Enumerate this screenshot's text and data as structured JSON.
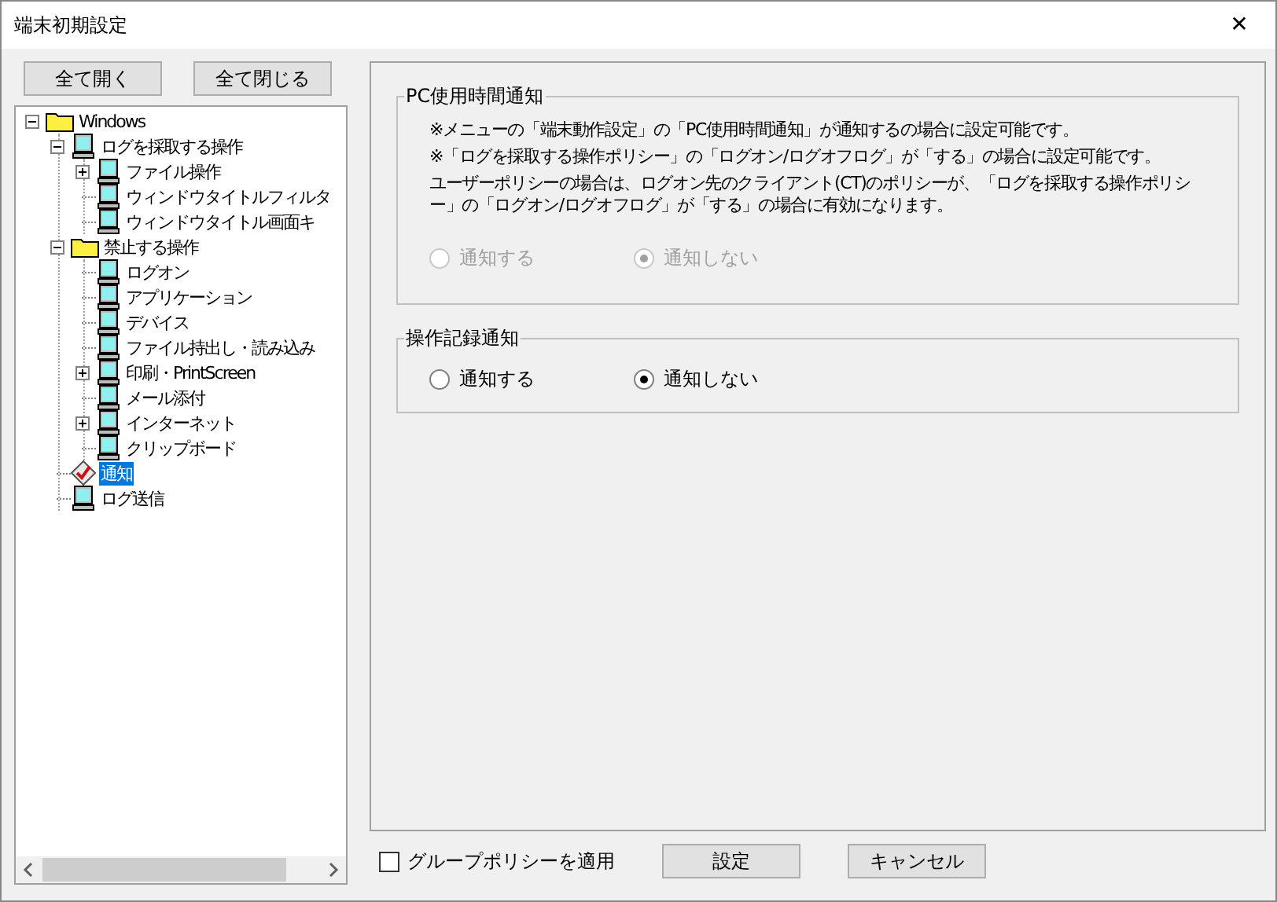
{
  "window": {
    "title": "端末初期設定",
    "close": "✕"
  },
  "tree_buttons": [
    "全て開く",
    "全て閉じる"
  ],
  "tree": [
    {
      "label": "Windows",
      "kind": "folder",
      "expanded": true,
      "selected": false,
      "children": [
        {
          "label": "ログを採取する操作",
          "kind": "pc",
          "expanded": true,
          "selected": false,
          "children": [
            {
              "label": "ファイル操作",
              "kind": "pc",
              "expanded": false,
              "selected": false
            },
            {
              "label": "ウィンドウタイトルフィルタ",
              "kind": "pc",
              "selected": false
            },
            {
              "label": "ウィンドウタイトル画面キ",
              "kind": "pc",
              "selected": false
            }
          ]
        },
        {
          "label": "禁止する操作",
          "kind": "folder",
          "expanded": true,
          "selected": false,
          "children": [
            {
              "label": "ログオン",
              "kind": "pc",
              "selected": false
            },
            {
              "label": "アプリケーション",
              "kind": "pc",
              "selected": false
            },
            {
              "label": "デバイス",
              "kind": "pc",
              "selected": false
            },
            {
              "label": "ファイル持出し・読み込み",
              "kind": "pc",
              "selected": false
            },
            {
              "label": "印刷・PrintScreen",
              "kind": "pc",
              "expanded": false,
              "selected": false
            },
            {
              "label": "メール添付",
              "kind": "pc",
              "selected": false
            },
            {
              "label": "インターネット",
              "kind": "pc",
              "expanded": false,
              "selected": false
            },
            {
              "label": "クリップボード",
              "kind": "pc",
              "selected": false
            }
          ]
        },
        {
          "label": "通知",
          "kind": "check",
          "selected": true
        },
        {
          "label": "ログ送信",
          "kind": "pc",
          "selected": false
        }
      ]
    }
  ],
  "groups": [
    {
      "title": "PC使用時間通知",
      "disabled": true,
      "notes": [
        "※メニューの「端末動作設定」の「PC使用時間通知」が通知するの場合に設定可能です。",
        "※「ログを採取する操作ポリシー」の「ログオン/ログオフログ」が「する」の場合に設定可能です。",
        "ユーザーポリシーの場合は、ログオン先のクライアント(CT)のポリシーが、「ログを採取する操作ポリシー」の「ログオン/ログオフログ」が「する」の場合に有効になります。"
      ],
      "options": [
        {
          "label": "通知する",
          "selected": false
        },
        {
          "label": "通知しない",
          "selected": true
        }
      ]
    },
    {
      "title": "操作記録通知",
      "disabled": false,
      "options": [
        {
          "label": "通知する",
          "selected": false
        },
        {
          "label": "通知しない",
          "selected": true
        }
      ]
    }
  ],
  "group_policy": {
    "label": "グループポリシーを適用",
    "checked": false
  },
  "buttons": [
    "設定",
    "キャンセル"
  ]
}
